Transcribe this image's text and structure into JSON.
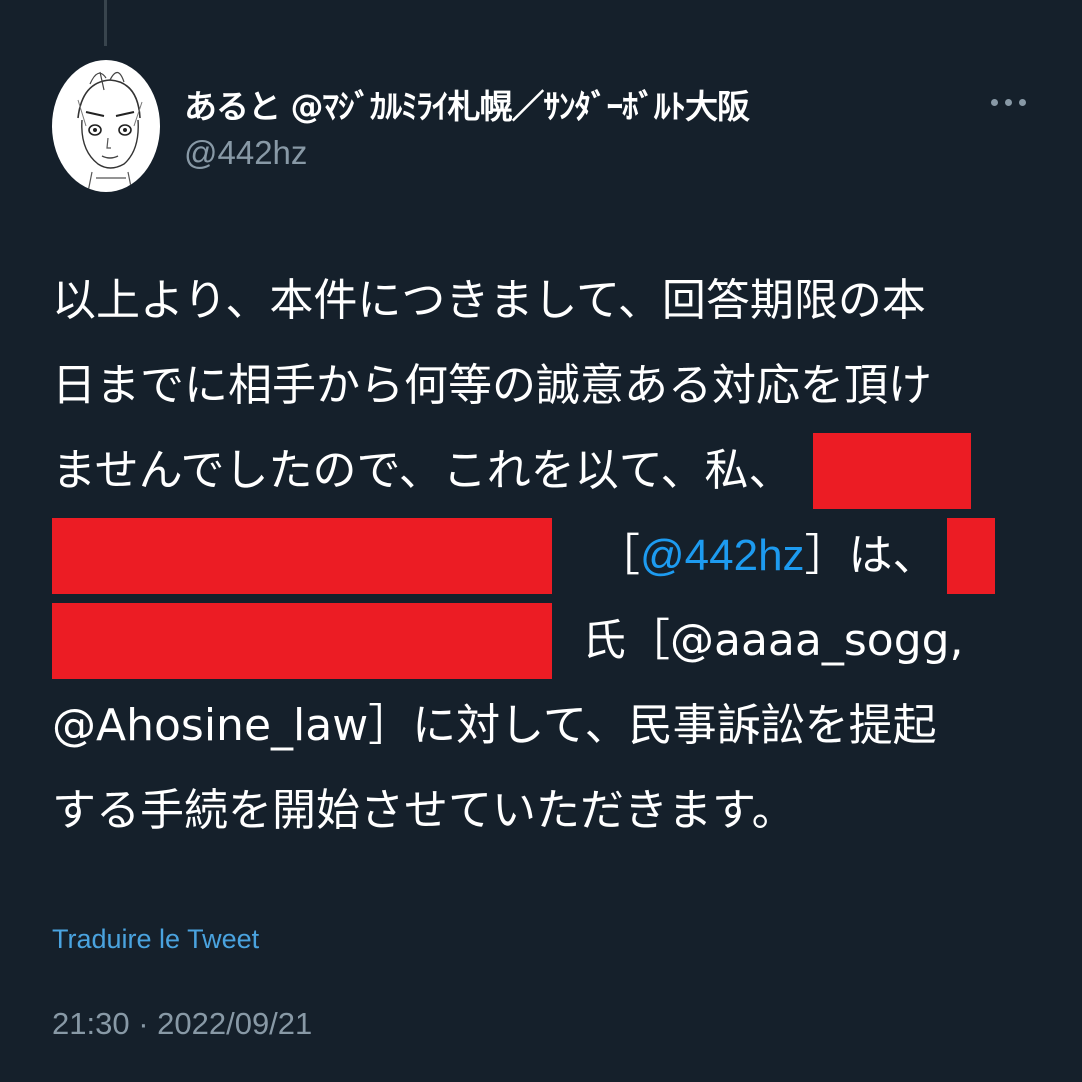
{
  "tweet": {
    "display_name": "あると @ﾏｼﾞｶﾙﾐﾗｲ札幌／ｻﾝﾀﾞｰﾎﾞﾙﾄ大阪",
    "handle": "@442hz",
    "body": {
      "line1": "以上より、本件につきまして、回答期限の本",
      "line2": "日までに相手から何等の誠意ある対応を頂け",
      "line3": "ませんでしたので、これを以て、私、",
      "line4_open": "［",
      "line4_mention": "@442hz",
      "line4_close": "］は、",
      "line5_text": "氏［@aaaa_sogg,",
      "line6": "@Ahosine_law］に対して、民事訴訟を提起",
      "line7": "する手続を開始させていただきます。"
    },
    "translate_link": "Traduire le Tweet",
    "timestamp": "21:30 · 2022/09/21"
  },
  "colors": {
    "background": "#15202b",
    "text": "#ffffff",
    "secondary": "#8899a6",
    "mention": "#1d9bf0",
    "redaction": "#ec1c24"
  },
  "icons": {
    "more": "more-horizontal-icon"
  }
}
